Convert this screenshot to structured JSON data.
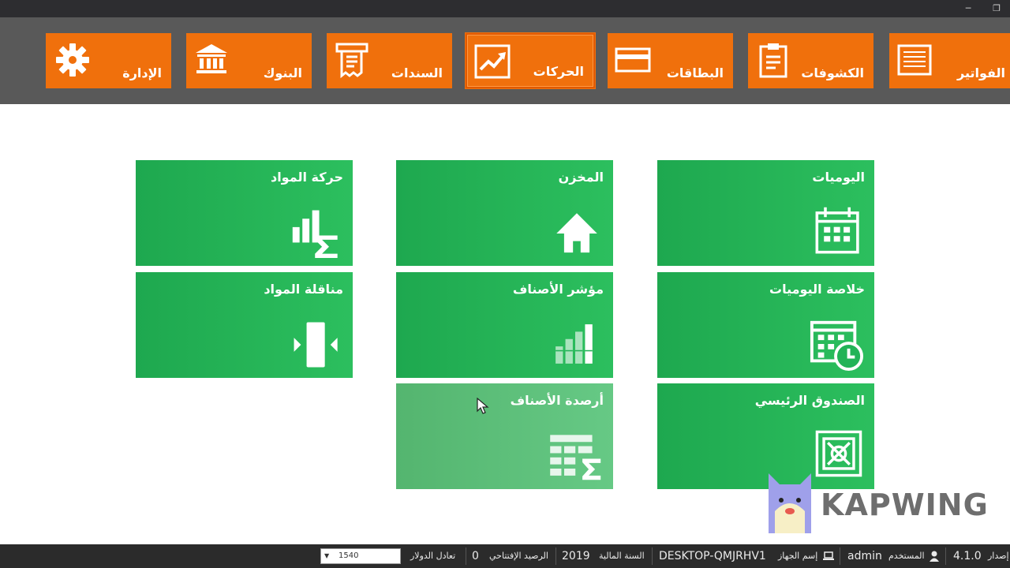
{
  "window": {
    "minimize_glyph": "─",
    "restore_glyph": "❐"
  },
  "nav": {
    "items": [
      {
        "label": "الإدارة",
        "icon": "gear-icon"
      },
      {
        "label": "البنوك",
        "icon": "bank-icon"
      },
      {
        "label": "السندات",
        "icon": "receipt-icon"
      },
      {
        "label": "الحركات",
        "icon": "trend-chart-icon",
        "active": true
      },
      {
        "label": "البطاقات",
        "icon": "card-icon"
      },
      {
        "label": "الكشوفات",
        "icon": "clipboard-icon"
      },
      {
        "label": "الفواتير",
        "icon": "invoice-icon"
      }
    ]
  },
  "tiles": {
    "journals": "اليوميات",
    "warehouse": "المخزن",
    "material_movement": "حركة المواد",
    "journal_summary": "خلاصة اليوميات",
    "item_indicator": "مؤشر الأصناف",
    "material_transfer": "مناقلة المواد",
    "main_cashbox": "الصندوق الرئيسي",
    "item_balances": "أرصدة الأصناف"
  },
  "status": {
    "version_label": "إصدار",
    "version": "4.1.0",
    "user_label": "المستخدم",
    "user": "admin",
    "device_label": "إسم الجهاز",
    "device": "DESKTOP-QMJRHV1",
    "fiscal_year_label": "السنة المالية",
    "fiscal_year": "2019",
    "opening_balance_label": "الرصيد الإفتتاحي",
    "opening_balance": "0",
    "dollar_rate_label": "تعادل الدولار",
    "dollar_rate": "1540"
  },
  "watermark": {
    "text": "KAPWING"
  },
  "colors": {
    "nav_orange": "#f0700c",
    "tile_green": "#22b357",
    "topbar_gray": "#595959",
    "statusbar": "#2b2b2b"
  }
}
